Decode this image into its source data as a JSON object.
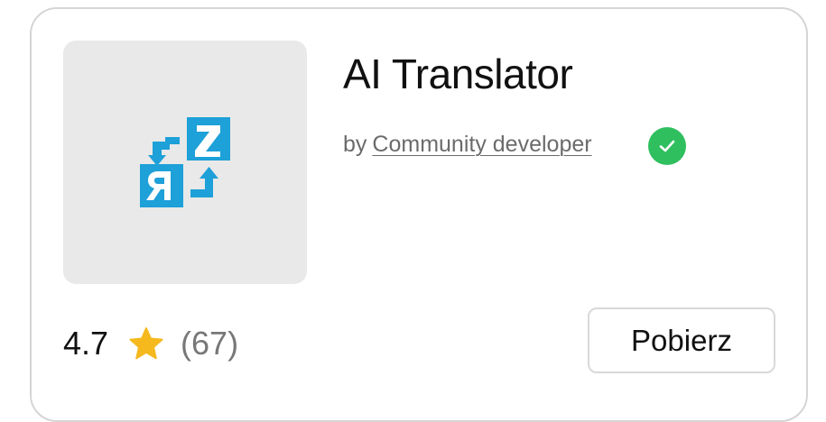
{
  "app": {
    "title": "AI Translator",
    "by_prefix": "by",
    "developer": "Community developer",
    "verified": true,
    "icon": "translate-icon",
    "icon_color": "#1ea0d8",
    "tile_color": "#e9e9e9"
  },
  "rating": {
    "value": "4.7",
    "count": "(67)",
    "star_icon": "star-icon",
    "star_color": "#f5b91e"
  },
  "actions": {
    "download_label": "Pobierz"
  },
  "colors": {
    "verified_badge": "#2fbf5f",
    "title_text": "#111111",
    "muted_text": "#6b6b6b"
  }
}
